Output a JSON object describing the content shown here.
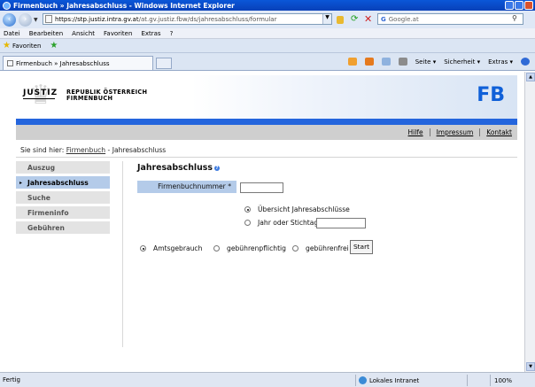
{
  "window": {
    "title": "Firmenbuch » Jahresabschluss - Windows Internet Explorer"
  },
  "address": {
    "url_https": "https://stp.justiz.intra.gv.at",
    "url_rest": "/at.gv.justiz.fbw/ds/jahresabschluss/formular",
    "search_placeholder": "Google.at"
  },
  "menu": [
    "Datei",
    "Bearbeiten",
    "Ansicht",
    "Favoriten",
    "Extras",
    "?"
  ],
  "favorites": {
    "label": "Favoriten"
  },
  "tab": {
    "label": "Firmenbuch » Jahresabschluss"
  },
  "commandbar": {
    "seite": "Seite ▾",
    "sicherheit": "Sicherheit ▾",
    "extras": "Extras ▾"
  },
  "header": {
    "logo_text": "JUSTIZ",
    "republik_line1": "REPUBLIK ÖSTERREICH",
    "republik_line2": "FIRMENBUCH",
    "fb": "FB"
  },
  "toplinks": [
    "Hilfe",
    "Impressum",
    "Kontakt"
  ],
  "breadcrumb": {
    "prefix": "Sie sind hier:",
    "link": "Firmenbuch",
    "sep": " - ",
    "current": "Jahresabschluss"
  },
  "nav": [
    {
      "label": "Auszug",
      "active": false
    },
    {
      "label": "Jahresabschluss",
      "active": true
    },
    {
      "label": "Suche",
      "active": false
    },
    {
      "label": "Firmeninfo",
      "active": false
    },
    {
      "label": "Gebühren",
      "active": false
    }
  ],
  "form": {
    "title": "Jahresabschluss",
    "fnr_label": "Firmenbuchnummer *",
    "fnr_value": "",
    "opt_uebersicht": "Übersicht Jahresabschlüsse",
    "opt_stichtag": "Jahr oder Stichtag",
    "stichtag_value": "",
    "opt_amtsgebrauch": "Amtsgebrauch",
    "opt_gebuehrenpflichtig": "gebührenpflichtig",
    "opt_gebuehrenfrei": "gebührenfrei",
    "start_label": "Start"
  },
  "status": {
    "left": "Fertig",
    "zone": "Lokales Intranet",
    "zoom": "100%"
  }
}
